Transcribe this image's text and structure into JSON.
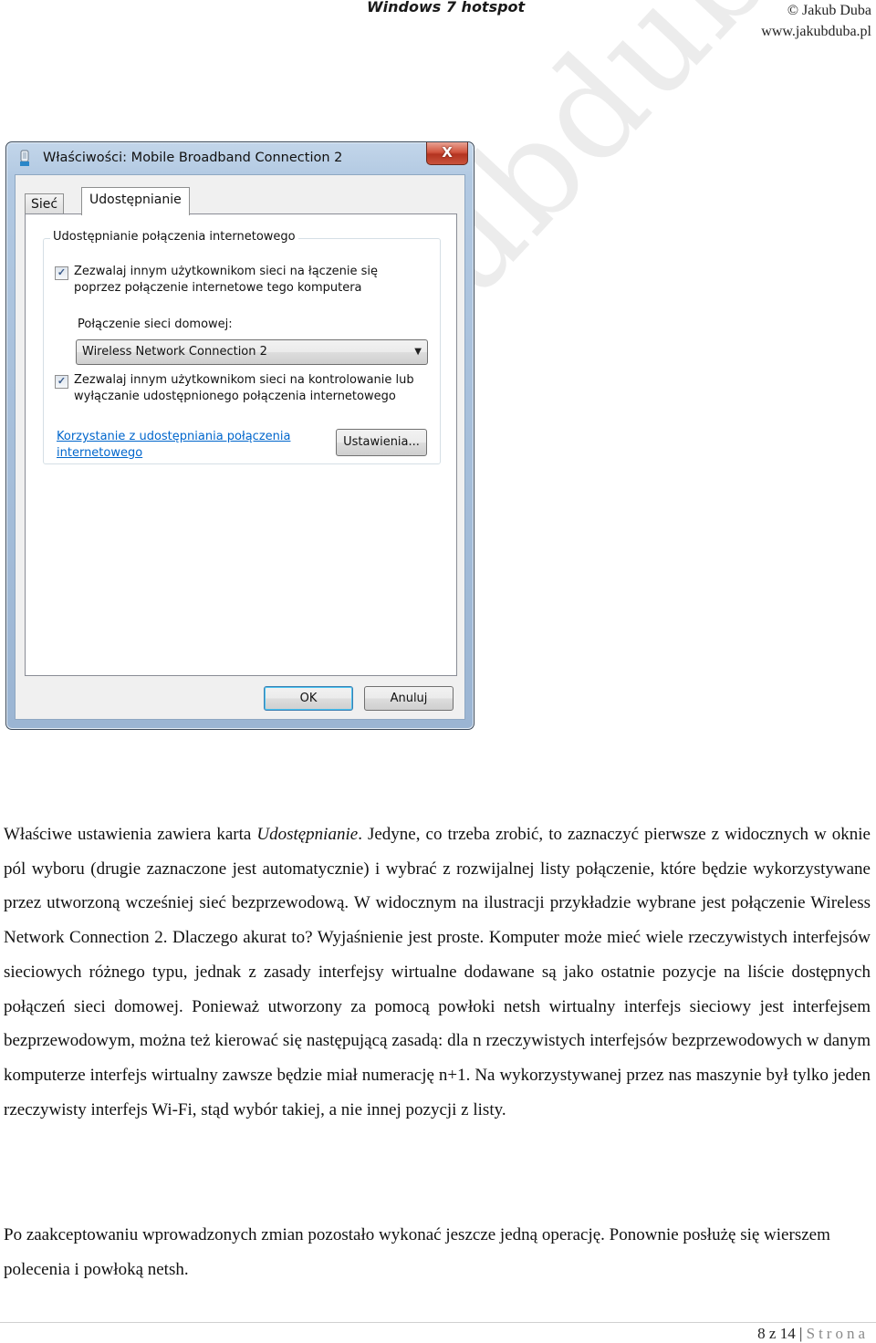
{
  "header": {
    "title": "Windows 7 hotspot",
    "author": "© Jakub Duba",
    "url": "www.jakubduba.pl"
  },
  "watermark": "www.jakubduba.pl",
  "dialog": {
    "title": "Właściwości: Mobile Broadband Connection 2",
    "window_icon": "network-adapter-icon",
    "close_label": "X",
    "tabs": [
      {
        "label": "Sieć",
        "active": false
      },
      {
        "label": "Udostępnianie",
        "active": true
      }
    ],
    "group_label": "Udostępnianie połączenia internetowego",
    "checkbox1": {
      "checked": true,
      "line1": "Zezwalaj innym użytkownikom sieci na łączenie się",
      "line2": "poprzez połączenie internetowe tego komputera"
    },
    "home_connection_label": "Połączenie sieci domowej:",
    "home_connection_value": "Wireless Network Connection 2",
    "checkbox2": {
      "checked": true,
      "line1": "Zezwalaj innym użytkownikom sieci na kontrolowanie lub",
      "line2": "wyłączanie udostępnionego połączenia internetowego"
    },
    "help_link": "Korzystanie z udostępniania połączenia internetowego",
    "settings_button": "Ustawienia...",
    "ok_button": "OK",
    "cancel_button": "Anuluj",
    "checkmark": "✓",
    "dropdown_arrow": "▼"
  },
  "body": {
    "p1_before": "Właściwe ustawienia zawiera karta ",
    "p1_em": "Udostępnianie",
    "p1_after": ". Jedyne, co trzeba zrobić, to zaznaczyć pierwsze z widocznych w oknie pól wyboru (drugie zaznaczone jest automatycznie) i wybrać z rozwijalnej listy połączenie, które będzie wykorzystywane przez utworzoną wcześniej sieć bezprzewodową. W widocznym na ilustracji przykładzie wybrane jest połączenie Wireless Network Connection 2. Dlaczego akurat to? Wyjaśnienie jest proste. Komputer może mieć wiele rzeczywistych interfejsów sieciowych różnego typu, jednak z zasady interfejsy wirtualne dodawane są jako ostatnie pozycje na liście dostępnych połączeń sieci domowej. Ponieważ utworzony za pomocą powłoki netsh wirtualny interfejs sieciowy jest interfejsem bezprzewodowym, można też kierować się następującą zasadą: dla n rzeczywistych interfejsów bezprzewodowych w danym komputerze interfejs wirtualny zawsze będzie miał numerację n+1. Na wykorzystywanej przez nas maszynie był tylko jeden rzeczywisty interfejs Wi-Fi, stąd wybór takiej, a nie innej pozycji z listy.",
    "p2": "Po zaakceptowaniu wprowadzonych zmian pozostało wykonać jeszcze jedną operację. Ponownie posłużę się wierszem polecenia i powłoką netsh."
  },
  "footer": {
    "page": "8 z 14",
    "separator": " | ",
    "label": "Strona"
  }
}
